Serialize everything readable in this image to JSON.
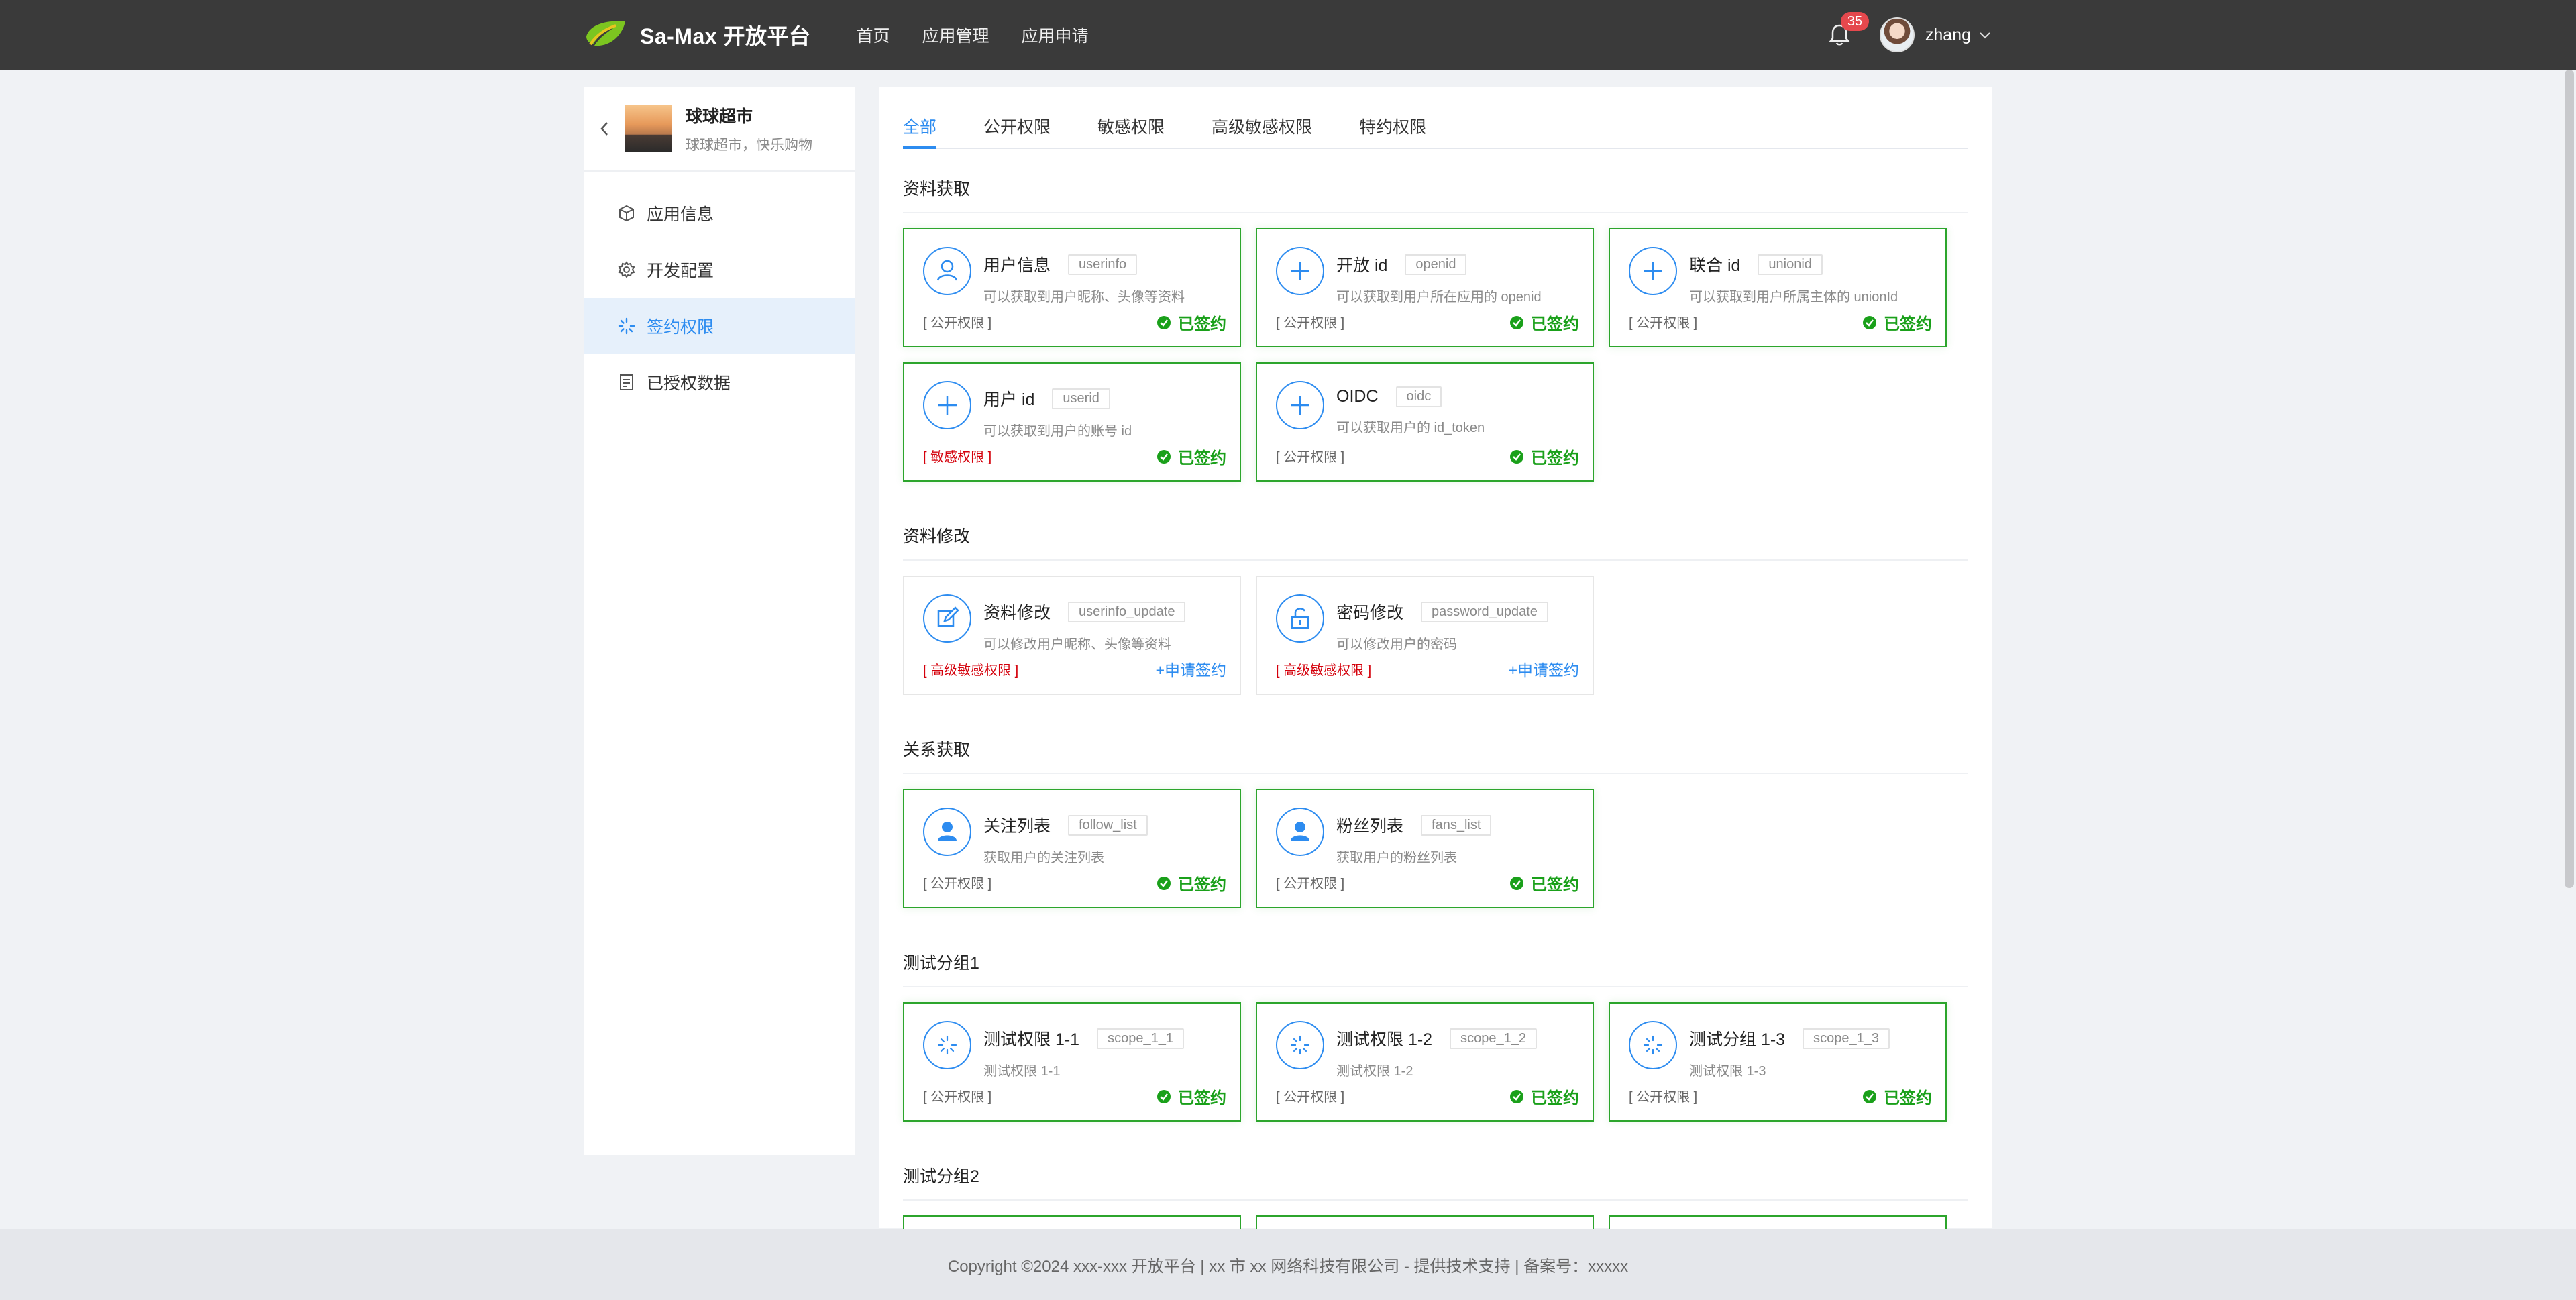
{
  "header": {
    "brand": "Sa-Max 开放平台",
    "nav": [
      "首页",
      "应用管理",
      "应用申请"
    ],
    "notification_count": "35",
    "username": "zhang"
  },
  "sidebar": {
    "app_name": "球球超市",
    "app_desc": "球球超市，快乐购物",
    "items": [
      {
        "label": "应用信息",
        "icon": "box-icon"
      },
      {
        "label": "开发配置",
        "icon": "gear-icon"
      },
      {
        "label": "签约权限",
        "icon": "spinner-icon",
        "active": true
      },
      {
        "label": "已授权数据",
        "icon": "document-icon"
      }
    ]
  },
  "tabs": [
    "全部",
    "公开权限",
    "敏感权限",
    "高级敏感权限",
    "特约权限"
  ],
  "active_tab": "全部",
  "sections": [
    {
      "title": "资料获取",
      "cards": [
        {
          "title": "用户信息",
          "code": "userinfo",
          "desc": "可以获取到用户昵称、头像等资料",
          "level": "[ 公开权限 ]",
          "status": "已签约",
          "icon": "user-outline-icon"
        },
        {
          "title": "开放 id",
          "code": "openid",
          "desc": "可以获取到用户所在应用的 openid",
          "level": "[ 公开权限 ]",
          "status": "已签约",
          "icon": "plus-circle-icon"
        },
        {
          "title": "联合 id",
          "code": "unionid",
          "desc": "可以获取到用户所属主体的 unionId",
          "level": "[ 公开权限 ]",
          "status": "已签约",
          "icon": "plus-circle-icon"
        },
        {
          "title": "用户 id",
          "code": "userid",
          "desc": "可以获取到用户的账号 id",
          "level": "[ 敏感权限 ]",
          "status": "已签约",
          "icon": "plus-circle-icon",
          "red": true
        },
        {
          "title": "OIDC",
          "code": "oidc",
          "desc": "可以获取用户的 id_token",
          "level": "[ 公开权限 ]",
          "status": "已签约",
          "icon": "plus-circle-icon"
        }
      ]
    },
    {
      "title": "资料修改",
      "cards": [
        {
          "title": "资料修改",
          "code": "userinfo_update",
          "desc": "可以修改用户昵称、头像等资料",
          "level": "[ 高级敏感权限 ]",
          "apply": "+申请签约",
          "icon": "edit-icon",
          "red": true
        },
        {
          "title": "密码修改",
          "code": "password_update",
          "desc": "可以修改用户的密码",
          "level": "[ 高级敏感权限 ]",
          "apply": "+申请签约",
          "icon": "unlock-icon",
          "red": true
        }
      ]
    },
    {
      "title": "关系获取",
      "cards": [
        {
          "title": "关注列表",
          "code": "follow_list",
          "desc": "获取用户的关注列表",
          "level": "[ 公开权限 ]",
          "status": "已签约",
          "icon": "user-solid-icon"
        },
        {
          "title": "粉丝列表",
          "code": "fans_list",
          "desc": "获取用户的粉丝列表",
          "level": "[ 公开权限 ]",
          "status": "已签约",
          "icon": "user-solid-icon"
        }
      ]
    },
    {
      "title": "测试分组1",
      "cards": [
        {
          "title": "测试权限 1-1",
          "code": "scope_1_1",
          "desc": "测试权限 1-1",
          "level": "[ 公开权限 ]",
          "status": "已签约",
          "icon": "spinner-icon"
        },
        {
          "title": "测试权限 1-2",
          "code": "scope_1_2",
          "desc": "测试权限 1-2",
          "level": "[ 公开权限 ]",
          "status": "已签约",
          "icon": "spinner-icon"
        },
        {
          "title": "测试分组 1-3",
          "code": "scope_1_3",
          "desc": "测试权限 1-3",
          "level": "[ 公开权限 ]",
          "status": "已签约",
          "icon": "spinner-icon"
        }
      ]
    },
    {
      "title": "测试分组2",
      "cards": []
    }
  ],
  "footer": "Copyright ©2024 xxx-xxx 开放平台 | xx 市 xx 网络科技有限公司 - 提供技术支持 | 备案号：xxxxx",
  "colors": {
    "accent": "#2d8cf0",
    "signed_border": "#2ca52c",
    "signed_text": "#1aa01a",
    "danger": "#d4000b",
    "header_bg": "#3a3a3a"
  }
}
